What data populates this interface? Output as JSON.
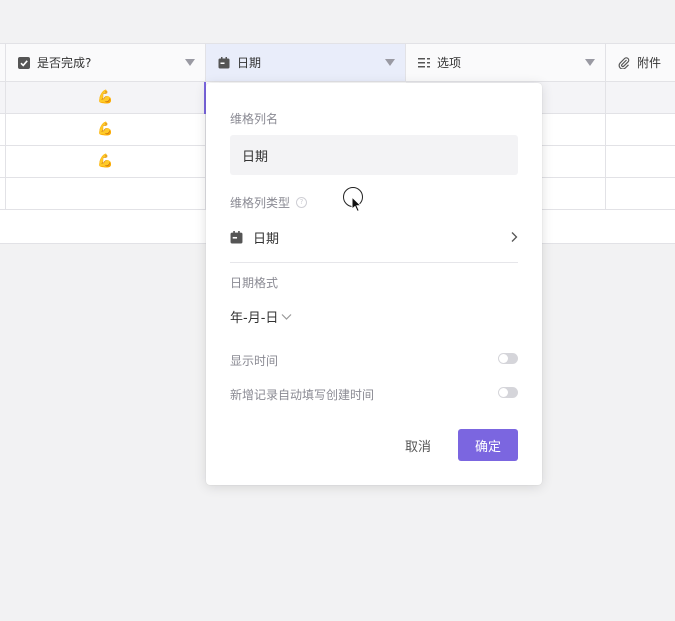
{
  "table": {
    "columns": [
      {
        "label": "是否完成?",
        "icon": "checkbox-icon"
      },
      {
        "label": "日期",
        "icon": "calendar-icon"
      },
      {
        "label": "选项",
        "icon": "list-icon"
      },
      {
        "label": "附件",
        "icon": "paperclip-icon"
      }
    ],
    "rows": [
      {
        "done": "💪"
      },
      {
        "done": "💪"
      },
      {
        "done": "💪"
      },
      {
        "done": ""
      }
    ]
  },
  "panel": {
    "name_label": "维格列名",
    "name_value": "日期",
    "type_label": "维格列类型",
    "type_value": "日期",
    "format_label": "日期格式",
    "format_value": "年-月-日",
    "show_time_label": "显示时间",
    "show_time_on": false,
    "auto_fill_label": "新增记录自动填写创建时间",
    "auto_fill_on": false,
    "cancel_label": "取消",
    "confirm_label": "确定"
  },
  "colors": {
    "accent": "#7b66e0",
    "selected_header": "#e9edfa"
  }
}
